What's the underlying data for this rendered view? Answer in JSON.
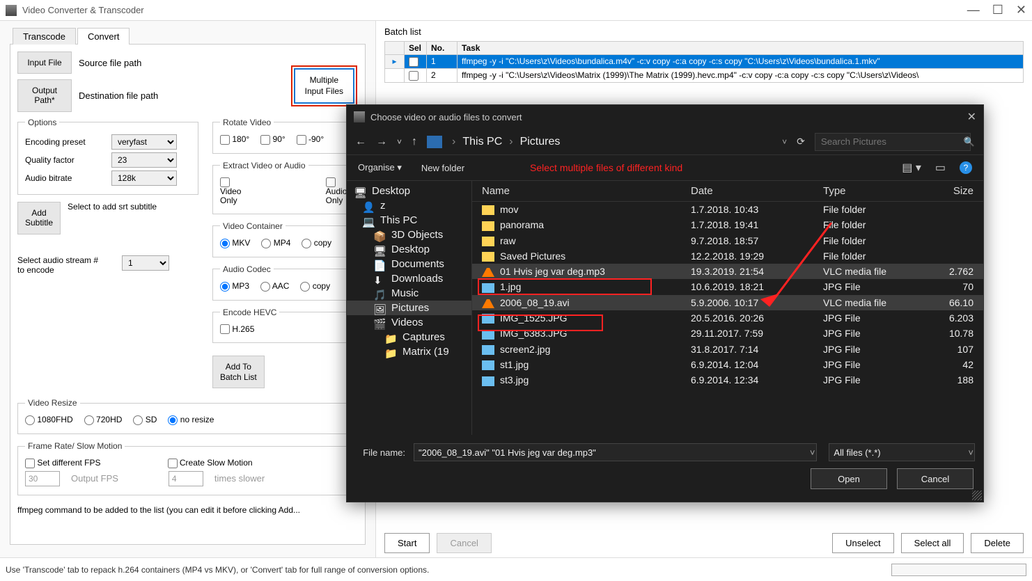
{
  "app": {
    "title": "Video Converter & Transcoder"
  },
  "window_buttons": {
    "min": "—",
    "max": "☐",
    "close": "✕"
  },
  "tabs": {
    "transcode": "Transcode",
    "convert": "Convert"
  },
  "convert": {
    "input_file_btn": "Input File",
    "source_label": "Source file path",
    "output_path_btn": "Output\nPath*",
    "dest_label": "Destination file path",
    "multiple_btn": "Multiple\nInput Files",
    "rotate_legend": "Rotate Video",
    "rotate": {
      "r180": "180°",
      "r90": "90°",
      "rneg90": "-90°"
    },
    "extract_legend": "Extract Video or Audio",
    "extract": {
      "vo": "Video\nOnly",
      "ao": "Audio\nOnly"
    },
    "options_legend": "Options",
    "enc_preset_label": "Encoding preset",
    "enc_preset_value": "veryfast",
    "qf_label": "Quality factor",
    "qf_value": "23",
    "abit_label": "Audio bitrate",
    "abit_value": "128k",
    "add_subtitle_btn": "Add\nSubtitle",
    "add_subtitle_label": "Select to add srt subtitle",
    "container_legend": "Video Container",
    "container": {
      "mkv": "MKV",
      "mp4": "MP4",
      "copy": "copy"
    },
    "acodec_legend": "Audio Codec",
    "acodec": {
      "mp3": "MP3",
      "aac": "AAC",
      "copy": "copy"
    },
    "hevc_legend": "Encode HEVC",
    "hevc_label": "H.265",
    "audio_stream_label": "Select audio stream #\nto encode",
    "audio_stream_value": "1",
    "add_to_list_btn": "Add To\nBatch List",
    "resize_legend": "Video Resize",
    "resize": {
      "fhd": "1080FHD",
      "hd": "720HD",
      "sd": "SD",
      "none": "no resize"
    },
    "fps_legend": "Frame Rate/ Slow Motion",
    "fps_chk": "Set different FPS",
    "slow_chk": "Create Slow Motion",
    "fps_value": "30",
    "fps_ph": "Output FPS",
    "slow_value": "4",
    "slow_ph": "times slower",
    "cmd_label": "ffmpeg command to be added to the list (you can edit it before clicking Add..."
  },
  "batch": {
    "label": "Batch list",
    "cols": {
      "sel": "Sel",
      "no": "No.",
      "task": "Task"
    },
    "rows": [
      {
        "no": "1",
        "task": "ffmpeg -y -i \"C:\\Users\\z\\Videos\\bundalica.m4v\" -c:v copy -c:a copy -c:s copy \"C:\\Users\\z\\Videos\\bundalica.1.mkv\""
      },
      {
        "no": "2",
        "task": "ffmpeg -y -i \"C:\\Users\\z\\Videos\\Matrix (1999)\\The Matrix (1999).hevc.mp4\" -c:v copy -c:a copy -c:s copy \"C:\\Users\\z\\Videos\\"
      }
    ],
    "start": "Start",
    "cancel": "Cancel",
    "unselect": "Unselect",
    "select_all": "Select all",
    "delete": "Delete"
  },
  "statusbar": {
    "msg": "Use 'Transcode' tab to repack h.264 containers (MP4 vs MKV), or 'Convert' tab for full range of conversion options."
  },
  "dialog": {
    "title": "Choose video or audio files to convert",
    "breadcrumb": {
      "a": "This PC",
      "b": "Pictures"
    },
    "search_ph": "Search Pictures",
    "organise": "Organise ▾",
    "new_folder": "New folder",
    "annotation": "Select multiple files of different kind",
    "tree": [
      {
        "label": "Desktop",
        "icon": "🖥",
        "lvl": 0
      },
      {
        "label": "z",
        "icon": "👤",
        "lvl": 1
      },
      {
        "label": "This PC",
        "icon": "💻",
        "lvl": 1
      },
      {
        "label": "3D Objects",
        "icon": "📦",
        "lvl": 2
      },
      {
        "label": "Desktop",
        "icon": "🖥",
        "lvl": 2
      },
      {
        "label": "Documents",
        "icon": "📄",
        "lvl": 2
      },
      {
        "label": "Downloads",
        "icon": "⬇",
        "lvl": 2
      },
      {
        "label": "Music",
        "icon": "🎵",
        "lvl": 2
      },
      {
        "label": "Pictures",
        "icon": "🖼",
        "lvl": 2
      },
      {
        "label": "Videos",
        "icon": "🎬",
        "lvl": 2
      },
      {
        "label": "Captures",
        "icon": "📁",
        "lvl": 3
      },
      {
        "label": "Matrix (19",
        "icon": "📁",
        "lvl": 3
      }
    ],
    "cols": {
      "name": "Name",
      "date": "Date",
      "type": "Type",
      "size": "Size"
    },
    "rows": [
      {
        "name": "mov",
        "date": "1.7.2018. 10:43",
        "type": "File folder",
        "size": "",
        "icon": "folder"
      },
      {
        "name": "panorama",
        "date": "1.7.2018. 19:41",
        "type": "File folder",
        "size": "",
        "icon": "folder"
      },
      {
        "name": "raw",
        "date": "9.7.2018. 18:57",
        "type": "File folder",
        "size": "",
        "icon": "folder"
      },
      {
        "name": "Saved Pictures",
        "date": "12.2.2018. 19:29",
        "type": "File folder",
        "size": "",
        "icon": "folder"
      },
      {
        "name": "01 Hvis jeg var deg.mp3",
        "date": "19.3.2019. 21:54",
        "type": "VLC media file",
        "size": "2.762",
        "icon": "vlc"
      },
      {
        "name": "1.jpg",
        "date": "10.6.2019. 18:21",
        "type": "JPG File",
        "size": "70",
        "icon": "img"
      },
      {
        "name": "2006_08_19.avi",
        "date": "5.9.2006. 10:17",
        "type": "VLC media file",
        "size": "66.10",
        "icon": "vlc"
      },
      {
        "name": "IMG_1525.JPG",
        "date": "20.5.2016. 20:26",
        "type": "JPG File",
        "size": "6.203",
        "icon": "img"
      },
      {
        "name": "IMG_6383.JPG",
        "date": "29.11.2017. 7:59",
        "type": "JPG File",
        "size": "10.78",
        "icon": "img"
      },
      {
        "name": "screen2.jpg",
        "date": "31.8.2017. 7:14",
        "type": "JPG File",
        "size": "107",
        "icon": "img"
      },
      {
        "name": "st1.jpg",
        "date": "6.9.2014. 12:04",
        "type": "JPG File",
        "size": "42",
        "icon": "img"
      },
      {
        "name": "st3.jpg",
        "date": "6.9.2014. 12:34",
        "type": "JPG File",
        "size": "188",
        "icon": "img"
      }
    ],
    "filename_label": "File name:",
    "filename_value": "\"2006_08_19.avi\" \"01 Hvis jeg var deg.mp3\"",
    "filetype_value": "All files (*.*)",
    "open": "Open",
    "cancel": "Cancel"
  }
}
